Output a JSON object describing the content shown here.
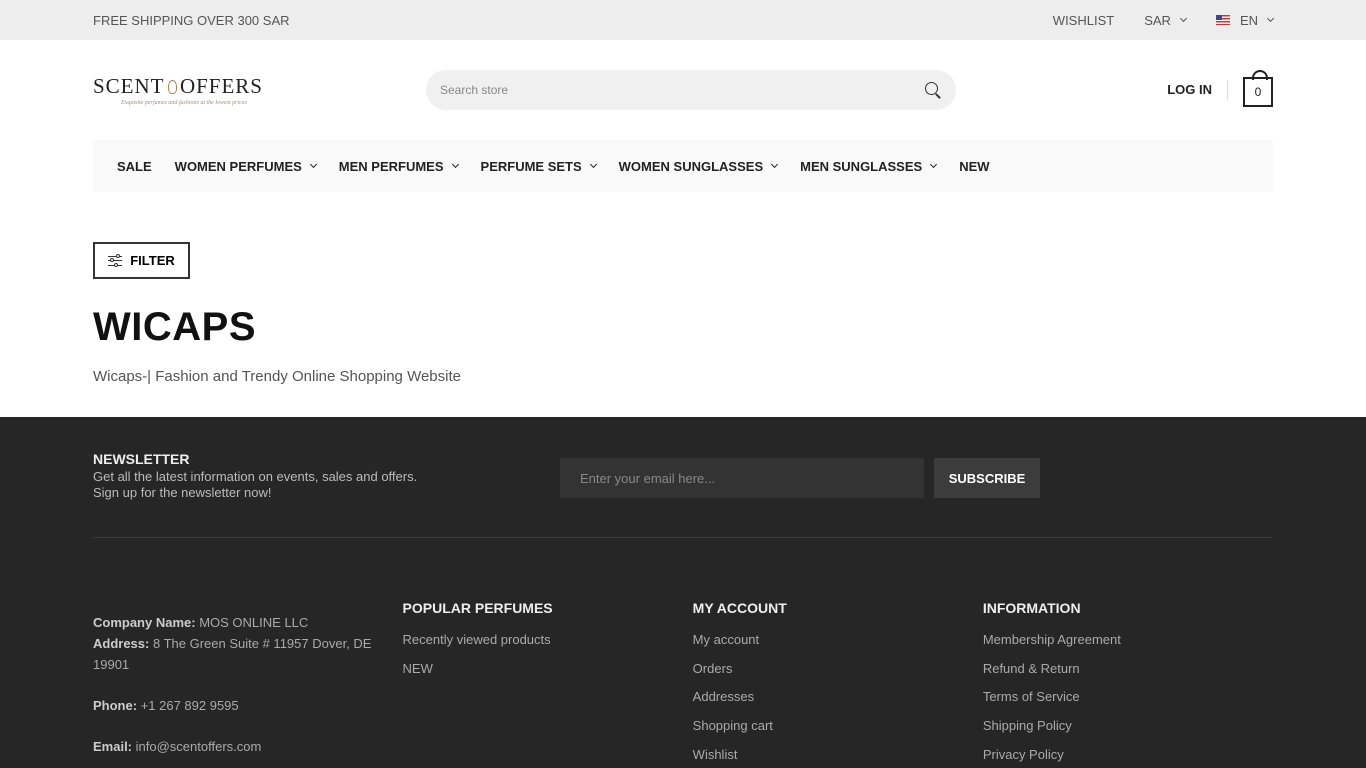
{
  "topbar": {
    "promo": "FREE SHIPPING OVER 300 SAR",
    "wishlist": "WISHLIST",
    "currency": "SAR",
    "language": "EN"
  },
  "header": {
    "logo_text": "SCENT OFFERS",
    "logo_tagline": "Exquisite perfumes and fashions at the lowest prices",
    "search_placeholder": "Search store",
    "login": "LOG IN",
    "cart_count": "0"
  },
  "nav": {
    "items": [
      {
        "label": "SALE"
      },
      {
        "label": "WOMEN PERFUMES"
      },
      {
        "label": "MEN PERFUMES"
      },
      {
        "label": "PERFUME SETS"
      },
      {
        "label": "WOMEN SUNGLASSES"
      },
      {
        "label": "MEN SUNGLASSES"
      },
      {
        "label": "NEW"
      }
    ]
  },
  "main": {
    "filter_label": "FILTER",
    "title": "WICAPS",
    "description": "Wicaps-| Fashion and Trendy Online Shopping Website"
  },
  "footer": {
    "newsletter": {
      "title": "NEWSLETTER",
      "description": "Get all the latest information on events, sales and offers. Sign up for the newsletter now!",
      "email_placeholder": "Enter your email here...",
      "subscribe": "SUBSCRIBE"
    },
    "contact": {
      "company_label": "Company Name:",
      "company": "MOS ONLINE LLC",
      "address_label": "Address:",
      "address": "8 The Green Suite # 11957 Dover, DE 19901",
      "phone_label": "Phone:",
      "phone": "+1 267 892 9595",
      "email_label": "Email:",
      "email": "info@scentoffers.com"
    },
    "popular": {
      "title": "POPULAR PERFUMES",
      "links": [
        "Recently viewed products",
        "NEW"
      ]
    },
    "account": {
      "title": "MY ACCOUNT",
      "links": [
        "My account",
        "Orders",
        "Addresses",
        "Shopping cart",
        "Wishlist"
      ]
    },
    "information": {
      "title": "INFORMATION",
      "links": [
        "Membership Agreement",
        "Refund & Return",
        "Terms of Service",
        "Shipping Policy",
        "Privacy Policy"
      ]
    }
  }
}
